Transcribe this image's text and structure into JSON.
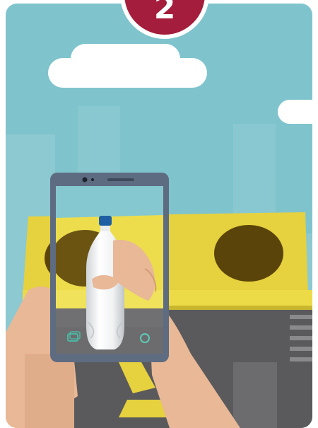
{
  "step": {
    "number": "2"
  },
  "colors": {
    "sky": "#7fc4cc",
    "bin_yellow": "#e6d13e",
    "bin_body": "#5a5a5c",
    "hole": "#5b4409",
    "badge": "#a51d3c",
    "skin": "#e8b897",
    "phone_frame": "#5e6c82",
    "recycle_symbol": "#e6d13e"
  },
  "icons": [
    "gallery-icon",
    "camera-shutter-icon",
    "switch-camera-icon",
    "recycle-icon",
    "bottle-icon"
  ]
}
